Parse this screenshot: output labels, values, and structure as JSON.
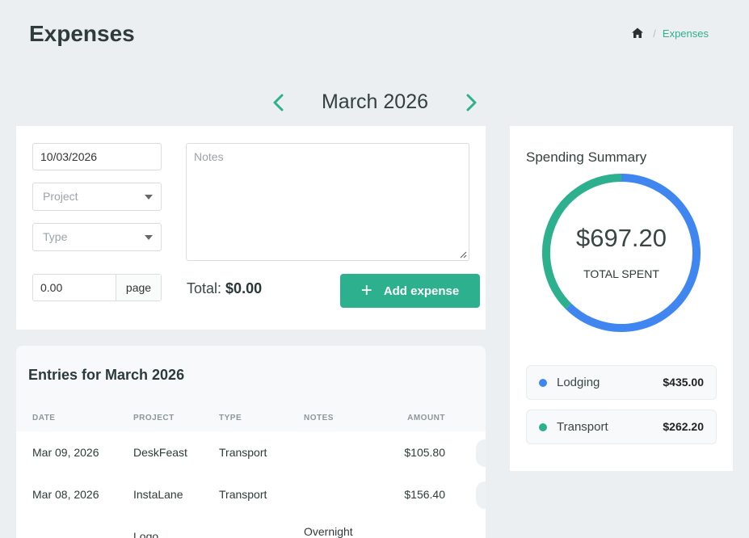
{
  "header": {
    "title": "Expenses",
    "breadcrumb": {
      "home_icon": "home-icon",
      "current": "Expenses"
    }
  },
  "month_nav": {
    "label": "March 2026",
    "prev_icon": "chevron-left-icon",
    "next_icon": "chevron-right-icon"
  },
  "form": {
    "date_value": "10/03/2026",
    "project_placeholder": "Project",
    "type_placeholder": "Type",
    "notes_placeholder": "Notes",
    "amount_value": "0.00",
    "amount_unit": "page",
    "total_label": "Total:",
    "total_value": "$0.00",
    "add_button": "Add expense"
  },
  "entries": {
    "heading": "Entries for March 2026",
    "columns": [
      "DATE",
      "PROJECT",
      "TYPE",
      "NOTES",
      "AMOUNT"
    ],
    "rows": [
      {
        "date": "Mar 09, 2026",
        "project": "DeskFeast",
        "type": "Transport",
        "notes": "",
        "amount": "$105.80"
      },
      {
        "date": "Mar 08, 2026",
        "project": "InstaLane",
        "type": "Transport",
        "notes": "",
        "amount": "$156.40"
      },
      {
        "date": "",
        "project": "Logo",
        "type": "",
        "notes": "Overnight",
        "amount": ""
      }
    ]
  },
  "summary": {
    "title": "Spending Summary",
    "total": "$697.20",
    "total_caption": "TOTAL SPENT",
    "items": [
      {
        "name": "Lodging",
        "value": "$435.00",
        "amount": 435.0,
        "color": "#3f86f1"
      },
      {
        "name": "Transport",
        "value": "$262.20",
        "amount": 262.2,
        "color": "#2db08e"
      }
    ]
  },
  "colors": {
    "accent": "#2db08e",
    "lodging": "#3f86f1",
    "background": "#ebeff2"
  }
}
